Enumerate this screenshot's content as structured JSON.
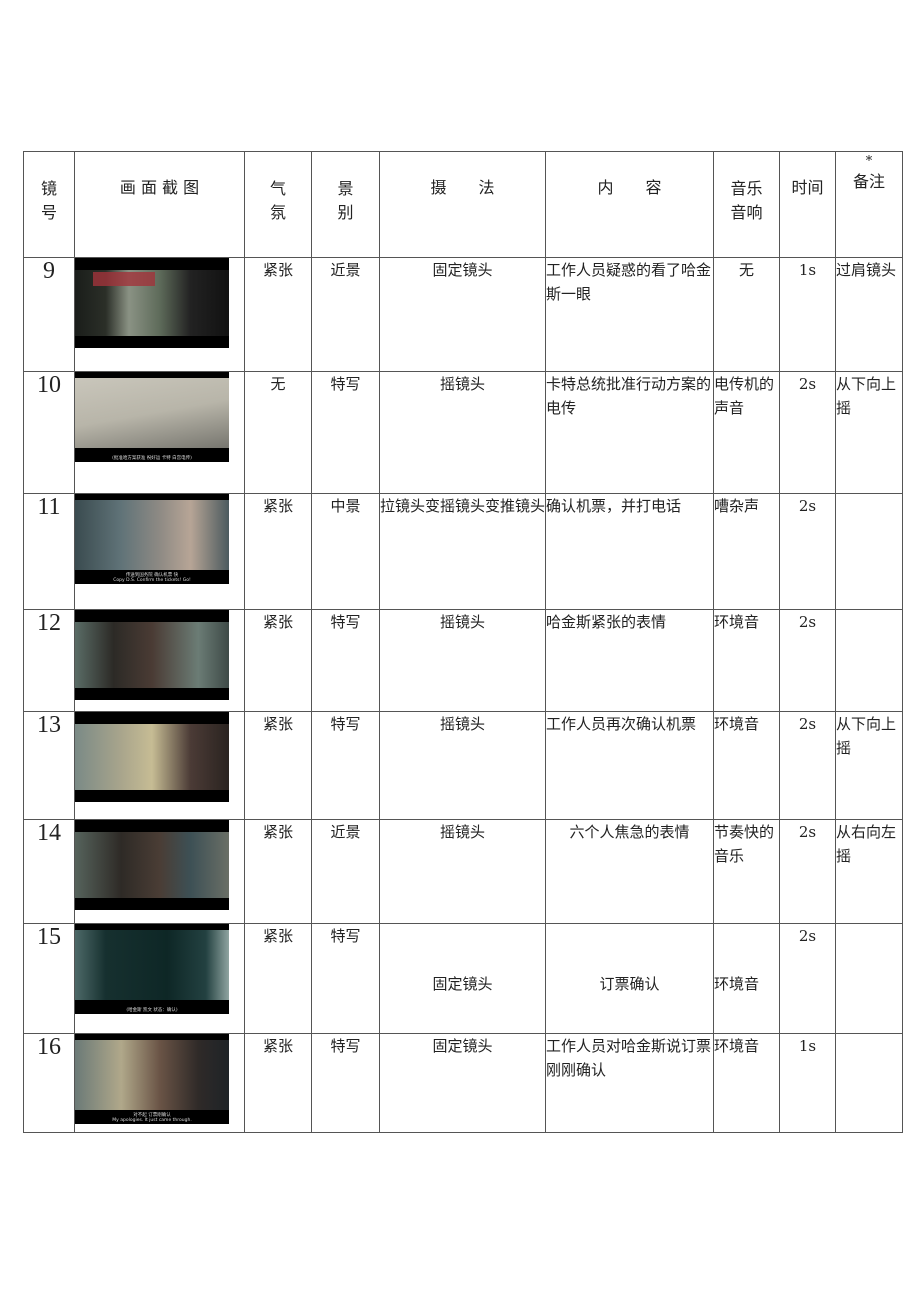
{
  "headers": {
    "shot_no": [
      "镜",
      "号"
    ],
    "screenshot": "画 面 截 图",
    "mood": [
      "气",
      "氛"
    ],
    "shot_size": [
      "景",
      "别"
    ],
    "camera": "摄　　法",
    "content": "内　　容",
    "sound": [
      "音乐",
      "音响"
    ],
    "duration": "时间",
    "note_star": "*",
    "note": "备注"
  },
  "rows": [
    {
      "no": "9",
      "thumb": "frame-desk-clerk",
      "subtitle": "",
      "subtitle_en": "",
      "mood": "紧张",
      "size": "近景",
      "camera": "固定镜头",
      "content": "工作人员疑惑的看了哈金斯一眼",
      "sound": "无",
      "time": "1s",
      "note": "过肩镜头"
    },
    {
      "no": "10",
      "thumb": "frame-telex",
      "subtitle": "(批准哈方案获准 祝好运 卡特 白宫电传)",
      "subtitle_en": "",
      "mood": "无",
      "size": "特写",
      "camera": "摇镜头",
      "content": "卡特总统批准行动方案的电传",
      "sound": "电传机的声音",
      "time": "2s",
      "note": "从下向上摇"
    },
    {
      "no": "11",
      "thumb": "frame-office-phone",
      "subtitle": "传送到国务院 确认机票 快",
      "subtitle_en": "Copy D.S. Confirm the tickets! Go!",
      "mood": "紧张",
      "size": "中景",
      "camera": "拉镜头变摇镜头变推镜头",
      "content": "确认机票，并打电话",
      "sound": "嘈杂声",
      "time": "2s",
      "note": ""
    },
    {
      "no": "12",
      "thumb": "frame-mendez-face",
      "subtitle": "",
      "subtitle_en": "",
      "mood": "紧张",
      "size": "特写",
      "camera": "摇镜头",
      "content": "哈金斯紧张的表情",
      "sound": "环境音",
      "time": "2s",
      "note": ""
    },
    {
      "no": "13",
      "thumb": "frame-clerk-profile",
      "subtitle": "",
      "subtitle_en": "",
      "mood": "紧张",
      "size": "特写",
      "camera": "摇镜头",
      "content": "工作人员再次确认机票",
      "sound": "环境音",
      "time": "2s",
      "note": "从下向上摇"
    },
    {
      "no": "14",
      "thumb": "frame-six-people",
      "subtitle": "",
      "subtitle_en": "",
      "mood": "紧张",
      "size": "近景",
      "camera": "摇镜头",
      "content": "六个人焦急的表情",
      "sound": "节奏快的音乐",
      "time": "2s",
      "note": "从右向左摇"
    },
    {
      "no": "15",
      "thumb": "frame-screen-status",
      "subtitle": "(哈金斯 凯文 状态：确认)",
      "subtitle_en": "",
      "mood": "紧张",
      "size": "特写",
      "camera": "固定镜头",
      "content": "订票确认",
      "sound": "环境音",
      "time": "2s",
      "note": ""
    },
    {
      "no": "16",
      "thumb": "frame-clerk-smile",
      "subtitle": "对不起 订票刚确认",
      "subtitle_en": "My apologies. It just came through.",
      "mood": "紧张",
      "size": "特写",
      "camera": "固定镜头",
      "content": "工作人员对哈金斯说订票刚刚确认",
      "sound": "环境音",
      "time": "1s",
      "note": ""
    }
  ]
}
